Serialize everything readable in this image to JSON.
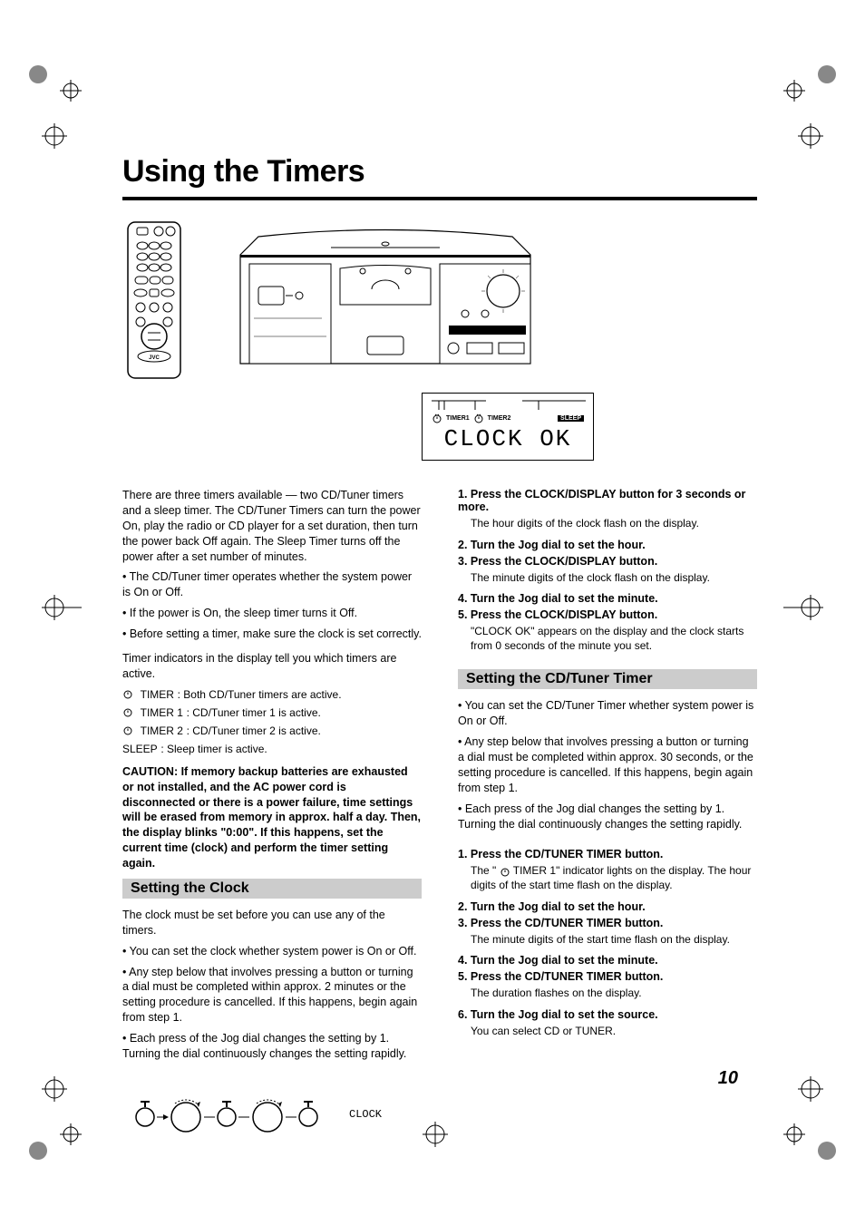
{
  "title": "Using the Timers",
  "intro": [
    "There are three timers available — two CD/Tuner timers and a sleep timer. The CD/Tuner Timers can turn the power On, play the radio or CD player for a set duration, then turn the power back Off again. The Sleep Timer turns off the power after a set number of minutes.",
    "• The CD/Tuner timer operates whether the system power is On or Off.",
    "• If the power is On, the sleep timer turns it Off.",
    "• Before setting a timer, make sure the clock is set correctly."
  ],
  "indicators_text": "Timer indicators in the display tell you which timers are active.",
  "indicator_lines": [
    {
      "label": "TIMER",
      "desc": "Both CD/Tuner timers are active."
    },
    {
      "label": "TIMER 1",
      "desc": "CD/Tuner timer 1 is active."
    },
    {
      "label": "TIMER 2",
      "desc": "CD/Tuner timer 2 is active."
    },
    {
      "label": "SLEEP",
      "desc": "Sleep timer is active."
    }
  ],
  "caution": "CAUTION: If memory backup batteries are exhausted or not installed, and the AC power cord is disconnected or there is a power failure, time settings will be erased from memory in approx. half a day. Then, the display blinks \"0:00\". If this happens, set the current time (clock) and perform the timer setting again.",
  "h2_clock": "Setting the Clock",
  "clock_intro": [
    "The clock must be set before you can use any of the timers.",
    "• You can set the clock whether system power is On or Off.",
    "• Any step below that involves pressing a button or turning a dial must be completed within approx. 2 minutes or the setting procedure is cancelled. If this happens, begin again from step 1.",
    "• Each press of the Jog dial changes the setting by 1. Turning the dial continuously changes the setting rapidly."
  ],
  "clock_diag_text": "CLOCK OK",
  "clock_steps": [
    {
      "bold": "1. Press the CLOCK/DISPLAY button for 3 seconds or more.",
      "note": "The hour digits of the clock flash on the display."
    },
    {
      "bold": "2. Turn the Jog dial to set the hour.",
      "note": ""
    },
    {
      "bold": "3. Press the CLOCK/DISPLAY button.",
      "note": "The minute digits of the clock flash on the display."
    },
    {
      "bold": "4. Turn the Jog dial to set the minute.",
      "note": ""
    },
    {
      "bold": "5. Press the CLOCK/DISPLAY button.",
      "note": "\"CLOCK OK\" appears on the display and the clock starts from 0 seconds of the minute you set."
    }
  ],
  "h2_cd": "Setting the CD/Tuner Timer",
  "cd_intro": [
    "• You can set the CD/Tuner Timer whether system power is On or Off.",
    "• Any step below that involves pressing a button or turning a dial must be completed within approx. 30 seconds, or the setting procedure is cancelled. If this happens, begin again from step 1.",
    "• Each press of the Jog dial changes the setting by 1. Turning the dial continuously changes the setting rapidly."
  ],
  "cd_steps": [
    {
      "bold": "1. Press the CD/TUNER TIMER button.",
      "note": "The \"  TIMER 1\" indicator lights on the display. The hour digits of the start time flash on the display."
    },
    {
      "bold": "2. Turn the Jog dial to set the hour.",
      "note": ""
    },
    {
      "bold": "3. Press the CD/TUNER TIMER button.",
      "note": "The minute digits of the start time flash on the display."
    },
    {
      "bold": "4. Turn the Jog dial to set the minute.",
      "note": ""
    },
    {
      "bold": "5. Press the CD/TUNER TIMER button.",
      "note": "The duration flashes on the display."
    },
    {
      "bold": "6. Turn the Jog dial to set the source.",
      "note": "You can select CD or TUNER."
    }
  ],
  "display_labels": {
    "t1": "TIMER1",
    "t2": "TIMER2",
    "sleep": "SLEEP"
  },
  "display_text": "CLOCK  OK",
  "page_number": "10"
}
